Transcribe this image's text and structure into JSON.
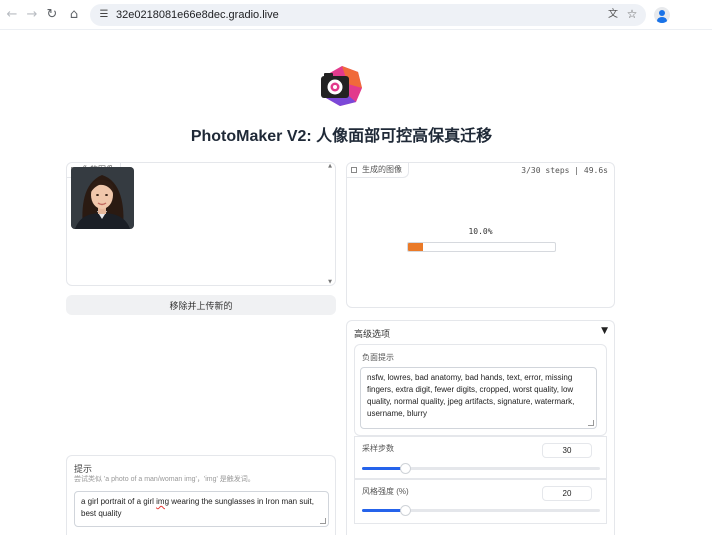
{
  "browser": {
    "url": "32e0218081e66e8dec.gradio.live",
    "icons": [
      "back-arrow-icon",
      "forward-arrow-icon",
      "reload-icon",
      "home-icon",
      "site-settings-icon",
      "translate-icon",
      "star-icon",
      "profile-icon"
    ]
  },
  "header": {
    "title": "PhotoMaker V2: 人像面部可控高保真迁移",
    "logo_icon": "camera-logo-icon"
  },
  "input_panel": {
    "label": "你的图像",
    "remove_button": "移除并上传新的"
  },
  "output_panel": {
    "label": "生成的图像",
    "status": "3/30 steps | 49.6s",
    "progress_text": "10.0%",
    "progress_fraction": 0.1,
    "progress_color": "#ea7a28"
  },
  "prompt": {
    "label": "提示",
    "info": "尝试类似 'a photo of a man/woman img'，'img' 是触发词。",
    "value_before": "a girl portrait of a girl ",
    "value_flagged": "img",
    "value_after": " wearing the sunglasses in Iron man suit, best quality"
  },
  "advanced": {
    "title": "高级选项",
    "negative_label": "负面提示",
    "negative_value": "nsfw, lowres, bad anatomy, bad hands, text, error, missing fingers, extra digit, fewer digits, cropped, worst quality, low quality, normal quality, jpeg artifacts, signature, watermark, username, blurry",
    "steps_label": "采样步数",
    "steps_value": "30",
    "steps_fraction": 0.18,
    "style_label": "风格强度 (%)",
    "style_value": "20",
    "style_fraction": 0.18,
    "accent_color": "#2563eb"
  }
}
